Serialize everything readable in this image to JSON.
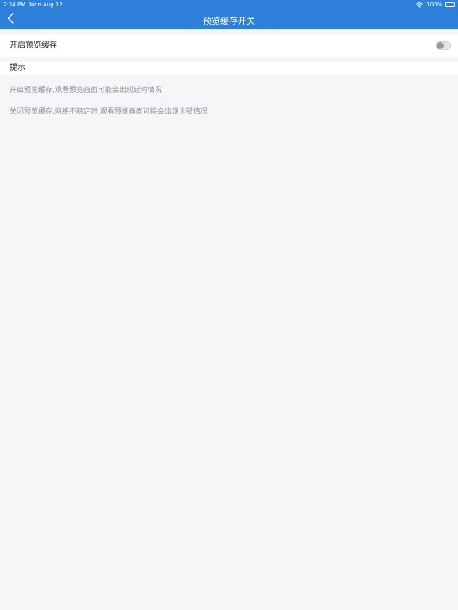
{
  "status_bar": {
    "time": "2:34 PM",
    "date": "Mon Aug 12",
    "battery": "100%",
    "battery_level": 1.0
  },
  "nav": {
    "title": "预览缓存开关",
    "back_icon": "chevron-left-icon"
  },
  "setting": {
    "label": "开启预览缓存",
    "enabled": false
  },
  "hint": {
    "title": "提示",
    "lines": [
      "开启预览缓存,观看预览画面可能会出现延时情况",
      "关闭预览缓存,网络不稳定时,观看预览画面可能会出现卡顿情况"
    ]
  },
  "colors": {
    "accent": "#2d7fd9",
    "background": "#f5f6f8",
    "hint_text": "#8e8e93"
  }
}
